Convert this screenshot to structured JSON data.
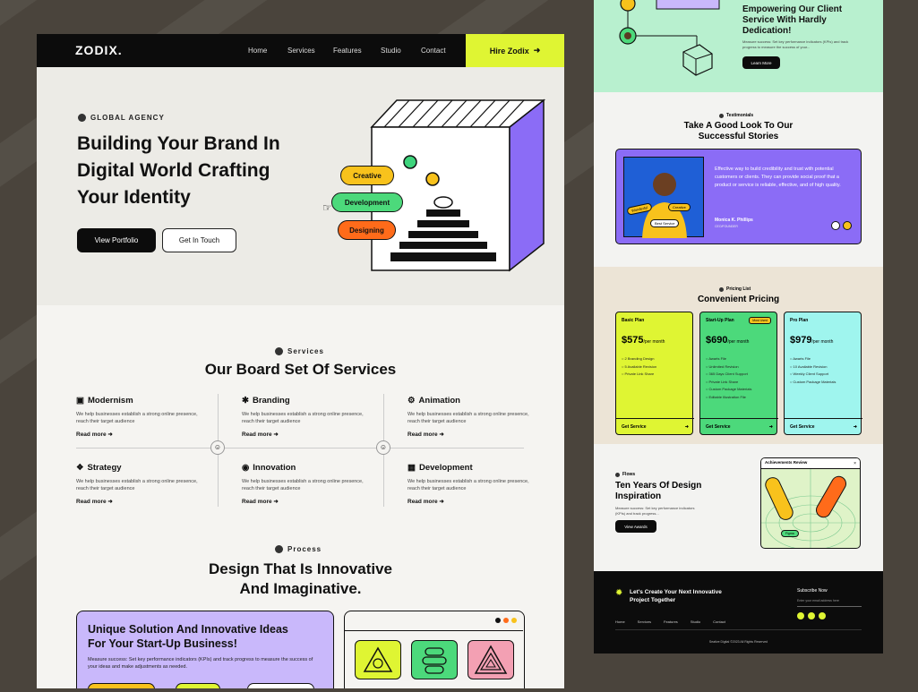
{
  "left": {
    "nav": {
      "logo": "ZODIX.",
      "links": [
        "Home",
        "Services",
        "Features",
        "Studio",
        "Contact"
      ],
      "cta": "Hire Zodix"
    },
    "hero": {
      "tag": "GLOBAL AGENCY",
      "title_lines": [
        "Building Your Brand In",
        "Digital World Crafting",
        "Your Identity"
      ],
      "btn_primary": "View Portfolio",
      "btn_secondary": "Get In Touch",
      "pills": [
        "Creative",
        "Development",
        "Designing"
      ]
    },
    "services": {
      "tag": "Services",
      "title": "Our Board Set Of Services",
      "items": [
        {
          "title": "Modernism",
          "desc": "We help businesses establish a strong online presence, reach their target audience",
          "more": "Read more"
        },
        {
          "title": "Branding",
          "desc": "We help businesses establish a strong online presence, reach their target audience",
          "more": "Read more"
        },
        {
          "title": "Animation",
          "desc": "We help businesses establish a strong online presence, reach their target audience",
          "more": "Read more"
        },
        {
          "title": "Strategy",
          "desc": "We help businesses establish a strong online presence, reach their target audience",
          "more": "Read more"
        },
        {
          "title": "Innovation",
          "desc": "We help businesses establish a strong online presence, reach their target audience",
          "more": "Read more"
        },
        {
          "title": "Development",
          "desc": "We help businesses establish a strong online presence, reach their target audience",
          "more": "Read more"
        }
      ]
    },
    "process": {
      "tag": "Process",
      "title_lines": [
        "Design That Is Innovative",
        "And Imaginative."
      ],
      "card_title_lines": [
        "Unique Solution And Innovative Ideas",
        "For Your Start-Up Business!"
      ],
      "card_desc": "Measure success: Set key performance indicators (KPIs) and track progress to measure the success of your ideas and make adjustments as needed."
    }
  },
  "right": {
    "client": {
      "title_lines": [
        "Empowering Our Client",
        "Service With Hardly",
        "Dedication!"
      ],
      "desc": "Measure success: Set key performance indicators (KPIs) and track progress to measure the success of your...",
      "btn": "Learn More"
    },
    "testimonials": {
      "tag": "Testimonials",
      "title_lines": [
        "Take A Good Look To Our",
        "Successful Stories"
      ],
      "quote": "Effective way to build credibility and trust with potential customers or clients. They can provide social proof that a product or service is reliable, effective, and of high quality.",
      "author": "Monica K. Phillips",
      "role": "CEO/FOUNDER",
      "tags": [
        "Wonderful",
        "Creative",
        "Best Service"
      ]
    },
    "pricing": {
      "tag": "Pricing List",
      "title": "Convenient Pricing",
      "plans": [
        {
          "name": "Basic Plan",
          "price": "$575",
          "per": "/per month",
          "features": [
            "2 Branding Design",
            "5 Available Revision",
            "Private Link Share"
          ],
          "cta": "Get Service",
          "color": "#dff533"
        },
        {
          "name": "Start-Up Plan",
          "price": "$690",
          "per": "/per month",
          "badge": "Most Used",
          "features": [
            "Awarts File",
            "Unlimited Revision",
            "365 Days Client Support",
            "Private Link Share",
            "Custom Package Materials",
            "Editable Illustration File"
          ],
          "cta": "Get Service",
          "color": "#4cd97b"
        },
        {
          "name": "Pro Plan",
          "price": "$979",
          "per": "/per month",
          "features": [
            "Awarts File",
            "10 Available Revision",
            "Weekly Client Support",
            "Custom Package Materials"
          ],
          "cta": "Get Service",
          "color": "#9ff5ee"
        }
      ]
    },
    "flows": {
      "tag": "Flows",
      "title_lines": [
        "Ten Years Of Design",
        "Inspiration"
      ],
      "desc": "Measure success: Set key performance indicators (KPIs) and track progress...",
      "btn": "View Awards",
      "card_title": "Achievements Review",
      "chip": "Figma"
    },
    "footer": {
      "title_lines": [
        "Let's Create Your Next Innovative",
        "Project Together"
      ],
      "subscribe": "Subscribe Now",
      "email_placeholder": "Enter your email address here",
      "links": [
        "Home",
        "Services",
        "Features",
        "Studio",
        "Contact"
      ],
      "copyright": "Seative Digital ©2023 All Rights Reserved"
    }
  },
  "colors": {
    "lime": "#dff533",
    "purple": "#8b6cf6",
    "green": "#4cd97b",
    "orange": "#ff6b1a",
    "mint": "#b8f0cf",
    "aqua": "#9ff5ee",
    "dark": "#0c0c0c"
  }
}
